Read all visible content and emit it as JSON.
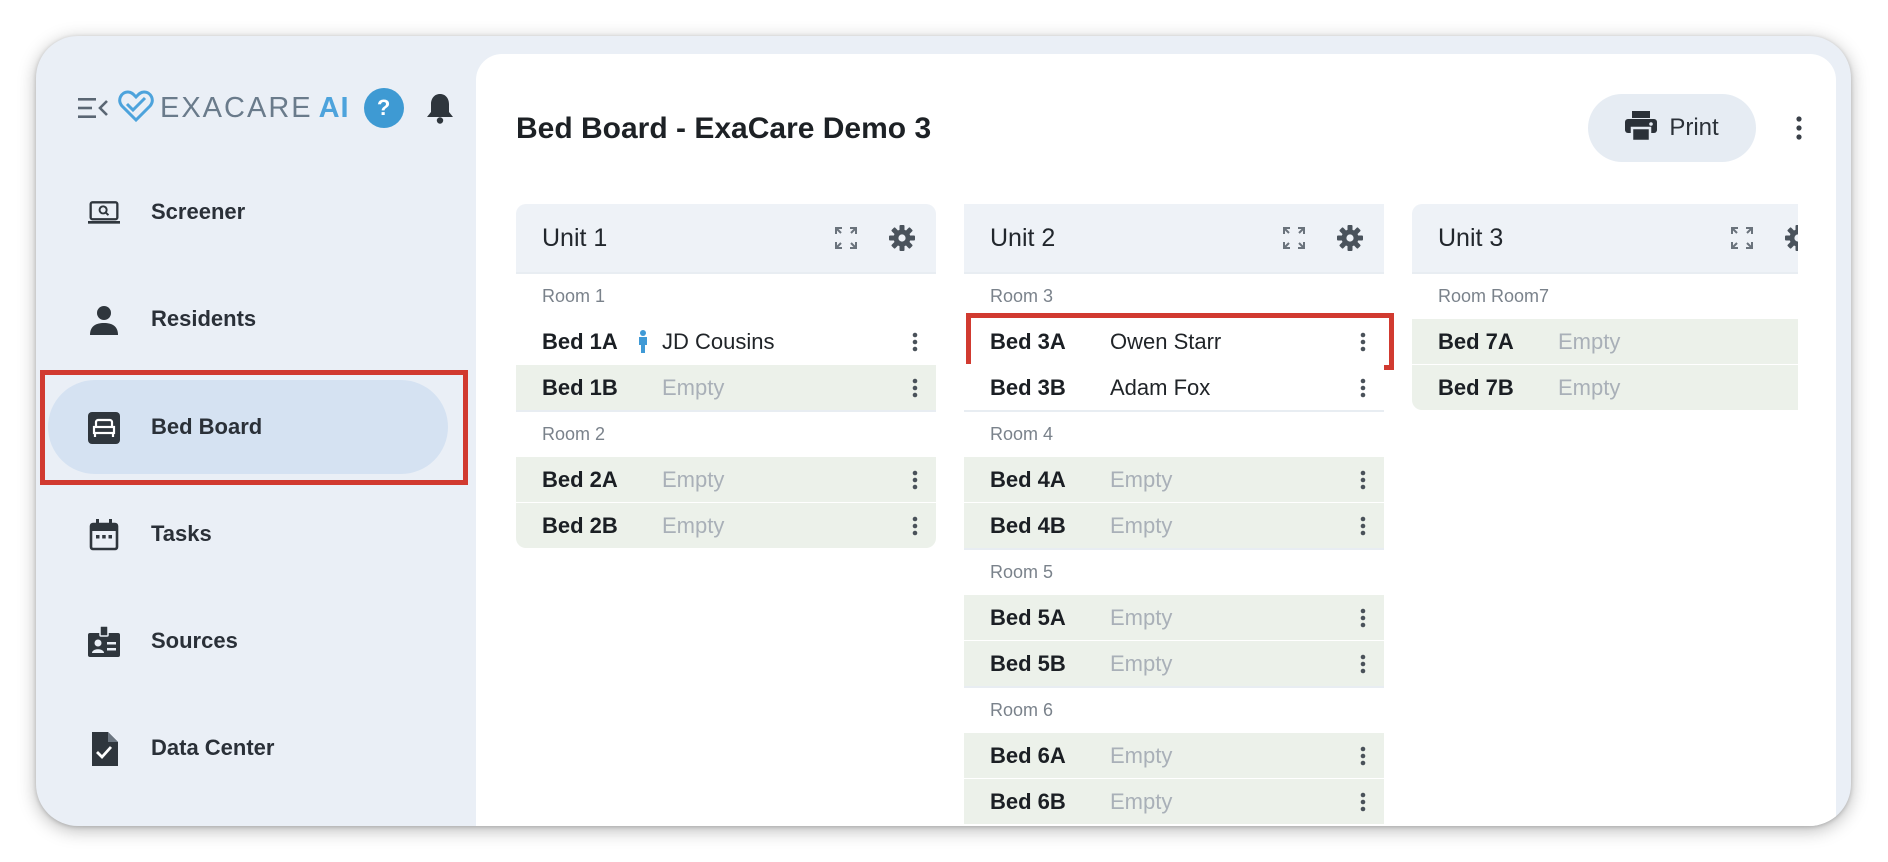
{
  "app": {
    "logo_text": "EXACARE",
    "logo_ai": "AI",
    "help_symbol": "?"
  },
  "sidebar": {
    "items": [
      {
        "label": "Screener",
        "icon": "laptop-search-icon"
      },
      {
        "label": "Residents",
        "icon": "person-icon"
      },
      {
        "label": "Bed Board",
        "icon": "bed-icon",
        "active": true
      },
      {
        "label": "Tasks",
        "icon": "calendar-icon"
      },
      {
        "label": "Sources",
        "icon": "id-badge-icon"
      },
      {
        "label": "Data Center",
        "icon": "file-check-icon"
      }
    ]
  },
  "header": {
    "title": "Bed Board - ExaCare Demo 3",
    "print_label": "Print"
  },
  "units": [
    {
      "name": "Unit 1",
      "rooms": [
        {
          "label": "Room 1",
          "beds": [
            {
              "bed": "Bed 1A",
              "status": "JD Cousins",
              "occupied": true
            },
            {
              "bed": "Bed 1B",
              "status": "Empty",
              "occupied": false
            }
          ]
        },
        {
          "label": "Room 2",
          "beds": [
            {
              "bed": "Bed 2A",
              "status": "Empty",
              "occupied": false
            },
            {
              "bed": "Bed 2B",
              "status": "Empty",
              "occupied": false
            }
          ]
        }
      ]
    },
    {
      "name": "Unit 2",
      "rooms": [
        {
          "label": "Room 3",
          "beds": [
            {
              "bed": "Bed 3A",
              "status": "Owen Starr",
              "occupied": true
            },
            {
              "bed": "Bed 3B",
              "status": "Adam Fox",
              "occupied": true
            }
          ]
        },
        {
          "label": "Room 4",
          "beds": [
            {
              "bed": "Bed 4A",
              "status": "Empty",
              "occupied": false
            },
            {
              "bed": "Bed 4B",
              "status": "Empty",
              "occupied": false
            }
          ]
        },
        {
          "label": "Room 5",
          "beds": [
            {
              "bed": "Bed 5A",
              "status": "Empty",
              "occupied": false
            },
            {
              "bed": "Bed 5B",
              "status": "Empty",
              "occupied": false
            }
          ]
        },
        {
          "label": "Room 6",
          "beds": [
            {
              "bed": "Bed 6A",
              "status": "Empty",
              "occupied": false
            },
            {
              "bed": "Bed 6B",
              "status": "Empty",
              "occupied": false
            }
          ]
        }
      ]
    },
    {
      "name": "Unit 3",
      "rooms": [
        {
          "label": "Room Room7",
          "beds": [
            {
              "bed": "Bed 7A",
              "status": "Empty",
              "occupied": false
            },
            {
              "bed": "Bed 7B",
              "status": "Empty",
              "occupied": false
            }
          ]
        }
      ]
    }
  ],
  "colors": {
    "accent": "#4da3dc",
    "highlight": "#d13a30",
    "empty_row": "#ecf1ea",
    "nav_active": "#d5e2f2"
  }
}
